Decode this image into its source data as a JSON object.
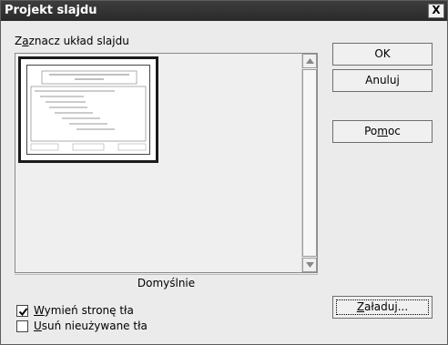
{
  "dialog": {
    "title": "Projekt slajdu",
    "close_glyph": "X"
  },
  "list": {
    "label_prefix": "Z",
    "label_mnemonic": "a",
    "label_rest": "znacz układ slajdu",
    "selected_layout": "Domyślnie"
  },
  "buttons": {
    "ok": "OK",
    "cancel": "Anuluj",
    "help_prefix": "Po",
    "help_mnemonic": "m",
    "help_rest": "oc",
    "load_mnemonic": "Z",
    "load_rest": "aładuj..."
  },
  "options": {
    "exchange_bg": {
      "mnemonic": "W",
      "rest": "ymień stronę tła",
      "checked": true
    },
    "delete_unused": {
      "mnemonic": "U",
      "rest": "suń nieużywane tła",
      "checked": false
    }
  },
  "colors": {
    "titlebar": "#2e2e2e",
    "dialog_bg": "#ebebeb"
  }
}
